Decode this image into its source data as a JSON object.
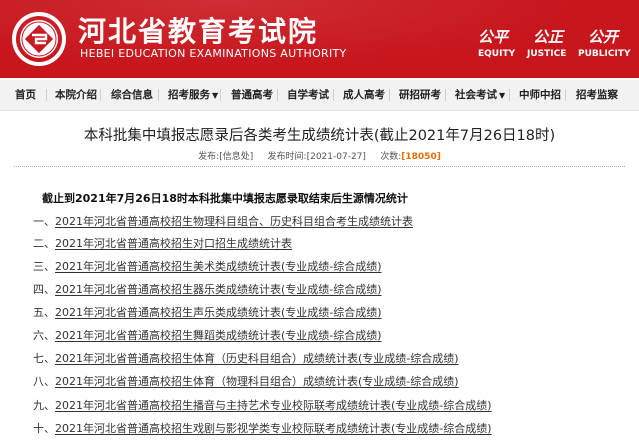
{
  "header": {
    "title": "河北省教育考试院",
    "subtitle": "HEBEI EDUCATION EXAMINATIONS AUTHORITY",
    "logo_icon": "seal-logo-icon",
    "mottos": [
      {
        "cn": "公平",
        "en": "EQUITY"
      },
      {
        "cn": "公正",
        "en": "JUSTICE"
      },
      {
        "cn": "公开",
        "en": "PUBLICITY"
      }
    ]
  },
  "nav": {
    "items": [
      {
        "label": "首页"
      },
      {
        "label": "本院介绍"
      },
      {
        "label": "综合信息"
      },
      {
        "label": "招考服务",
        "arrow": "▼"
      },
      {
        "label": "普通高考"
      },
      {
        "label": "自学考试"
      },
      {
        "label": "成人高考"
      },
      {
        "label": "研招研考"
      },
      {
        "label": "社会考试",
        "arrow": "▼"
      },
      {
        "label": "中师中招"
      },
      {
        "label": "招考监察"
      }
    ]
  },
  "article": {
    "title": "本科批集中填报志愿录后各类考生成绩统计表(截止2021年7月26日18时)",
    "meta": {
      "publisher_label": "发布:",
      "publisher": "[信息处]",
      "time_label": "发布时间:",
      "time": "[2021-07-27]",
      "hits_label": "次数:",
      "hits": "[18050]"
    },
    "subheading": "截止到2021年7月26日18时本科批集中填报志愿录取结束后生源情况统计",
    "items": [
      {
        "num": "一、",
        "text": "2021年河北省普通高校招生物理科目组合、历史科目组合考生成绩统计表"
      },
      {
        "num": "二、",
        "text": "2021年河北省普通高校招生对口招生成绩统计表"
      },
      {
        "num": "三、",
        "text": "2021年河北省普通高校招生美术类成绩统计表(专业成绩-综合成绩)"
      },
      {
        "num": "四、",
        "text": "2021年河北省普通高校招生器乐类成绩统计表(专业成绩-综合成绩)"
      },
      {
        "num": "五、",
        "text": "2021年河北省普通高校招生声乐类成绩统计表(专业成绩-综合成绩)"
      },
      {
        "num": "六、",
        "text": "2021年河北省普通高校招生舞蹈类成绩统计表(专业成绩-综合成绩)"
      },
      {
        "num": "七、",
        "text": "2021年河北省普通高校招生体育（历史科目组合）成绩统计表(专业成绩-综合成绩)"
      },
      {
        "num": "八、",
        "text": "2021年河北省普通高校招生体育（物理科目组合）成绩统计表(专业成绩-综合成绩)"
      },
      {
        "num": "九、",
        "text": "2021年河北省普通高校招生播音与主持艺术专业校际联考成绩统计表(专业成绩-综合成绩)"
      },
      {
        "num": "十、",
        "text": "2021年河北省普通高校招生戏剧与影视学类专业校际联考成绩统计表(专业成绩-综合成绩)"
      }
    ]
  }
}
